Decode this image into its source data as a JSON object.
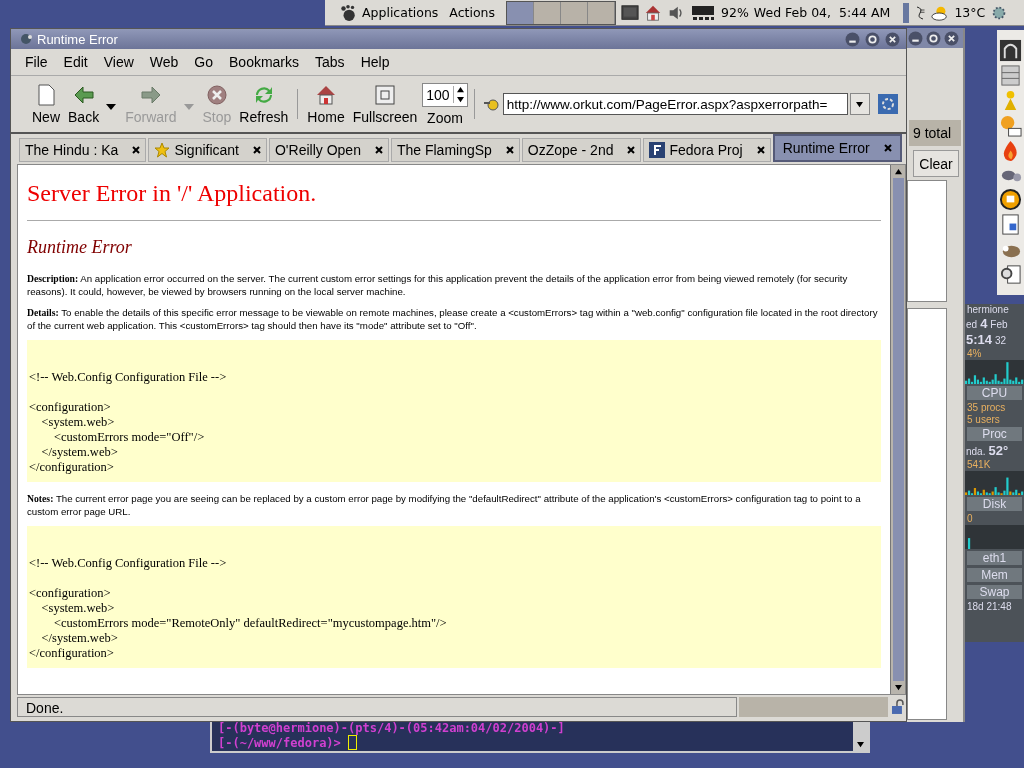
{
  "panel": {
    "menus": [
      "Applications",
      "Actions"
    ],
    "workspaces": [
      {
        "selected": true
      },
      {
        "selected": false
      },
      {
        "selected": false
      },
      {
        "selected": false
      }
    ],
    "battery": "92%",
    "clock": "Wed Feb 04,  5:44 AM",
    "temperature": "13°C"
  },
  "browser": {
    "title": "Runtime Error",
    "menu": [
      "File",
      "Edit",
      "View",
      "Web",
      "Go",
      "Bookmarks",
      "Tabs",
      "Help"
    ],
    "toolbar": [
      {
        "label": "New",
        "disabled": false,
        "dropdown": false
      },
      {
        "label": "Back",
        "disabled": false,
        "dropdown": true
      },
      {
        "label": "Forward",
        "disabled": true,
        "dropdown": true
      },
      {
        "label": "Stop",
        "disabled": true,
        "dropdown": false
      },
      {
        "label": "Refresh",
        "disabled": false,
        "dropdown": false
      },
      {
        "label": "Home",
        "disabled": false,
        "dropdown": false
      },
      {
        "label": "Fullscreen",
        "disabled": false,
        "dropdown": false
      }
    ],
    "zoom": {
      "label": "Zoom",
      "value": "100"
    },
    "url": "http://www.orkut.com/PageError.aspx?aspxerrorpath=",
    "tabs": [
      {
        "label": "The Hindu : Ka",
        "selected": false,
        "kind": "plain"
      },
      {
        "label": "Significant",
        "selected": false,
        "kind": "starred"
      },
      {
        "label": "O'Reilly Open",
        "selected": false,
        "kind": "plain"
      },
      {
        "label": "The FlamingSp",
        "selected": false,
        "kind": "plain"
      },
      {
        "label": "OzZope - 2nd",
        "selected": false,
        "kind": "plain"
      },
      {
        "label": "Fedora Proj",
        "selected": false,
        "kind": "branded"
      },
      {
        "label": "Runtime Error",
        "selected": true,
        "kind": "plain"
      }
    ],
    "status": "Done."
  },
  "page": {
    "heading": "Server Error in '/' Application.",
    "subheading": "Runtime Error",
    "sections": [
      {
        "kind": "paragraph",
        "label": "Description:",
        "text": "An application error occurred on the server. The current custom error settings for this application prevent the details of the application error from being viewed remotely (for security reasons). It could, however, be viewed by browsers running on the local server machine."
      },
      {
        "kind": "paragraph",
        "label": "Details:",
        "text": "To enable the details of this specific error message to be viewable on remote machines, please create a <customErrors> tag within a \"web.config\" configuration file located in the root directory of the current web application. This <customErrors> tag should then have its \"mode\" attribute set to \"Off\"."
      },
      {
        "kind": "code",
        "comment": "<!-- Web.Config Configuration File -->",
        "lines": [
          "<configuration>",
          "    <system.web>",
          "        <customErrors mode=\"Off\"/>",
          "    </system.web>",
          "</configuration>"
        ]
      },
      {
        "kind": "paragraph",
        "label": "Notes:",
        "text": "The current error page you are seeing can be replaced by a custom error page by modifying the \"defaultRedirect\" attribute of the application's <customErrors> configuration tag to point to a custom error page URL."
      },
      {
        "kind": "code",
        "comment": "<!-- Web.Config Configuration File -->",
        "lines": [
          "<configuration>",
          "    <system.web>",
          "        <customErrors mode=\"RemoteOnly\" defaultRedirect=\"mycustompage.htm\"/>",
          "    </system.web>",
          "</configuration>"
        ]
      }
    ]
  },
  "back_window": {
    "count": "9 total",
    "button": "Clear"
  },
  "terminal": {
    "lines": [
      "[-(byte@hermione)-(pts/4)-(05:42am:04/02/2004)-]",
      "[-(~/www/fedora)> "
    ]
  },
  "monitor": {
    "host": "hermione",
    "date": [
      "ed",
      "4",
      "Feb"
    ],
    "time": [
      "5:14",
      "32"
    ],
    "cpu_load": "4%",
    "cpu": "CPU",
    "procs": "35 procs",
    "users": "5 users",
    "proc": "Proc",
    "sensor": [
      "nda.",
      "52°"
    ],
    "memory_value": "541K",
    "disk": "Disk",
    "disk_value": "0",
    "net": "eth1",
    "mem": "Mem",
    "swap": "Swap",
    "uptime": "18d 21:48"
  }
}
